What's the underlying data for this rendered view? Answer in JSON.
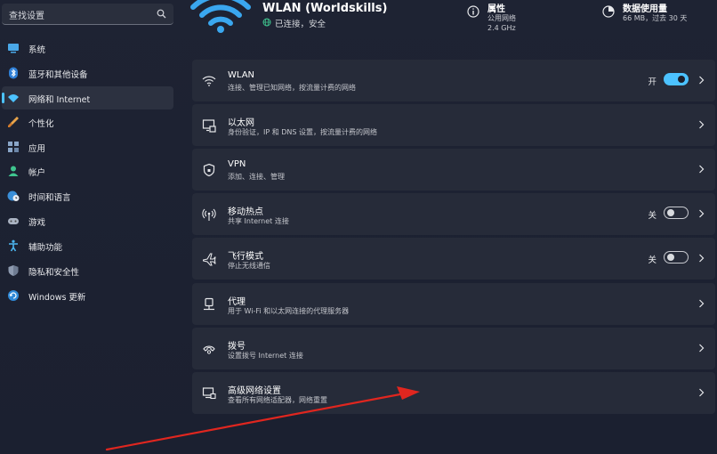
{
  "search": {
    "placeholder": "查找设置"
  },
  "sidebar": {
    "items": [
      {
        "label": "系统",
        "icon": "monitor-icon"
      },
      {
        "label": "蓝牙和其他设备",
        "icon": "bluetooth-icon"
      },
      {
        "label": "网络和 Internet",
        "icon": "wifi-icon",
        "active": true
      },
      {
        "label": "个性化",
        "icon": "brush-icon"
      },
      {
        "label": "应用",
        "icon": "apps-icon"
      },
      {
        "label": "帐户",
        "icon": "account-icon"
      },
      {
        "label": "时间和语言",
        "icon": "globe-clock-icon"
      },
      {
        "label": "游戏",
        "icon": "gamepad-icon"
      },
      {
        "label": "辅助功能",
        "icon": "accessibility-icon"
      },
      {
        "label": "隐私和安全性",
        "icon": "shield-icon"
      },
      {
        "label": "Windows 更新",
        "icon": "update-icon"
      }
    ]
  },
  "header": {
    "network_name": "WLAN (Worldskills)",
    "status": "已连接，安全",
    "properties": {
      "title": "属性",
      "line1": "公用网络",
      "line2": "2.4 GHz"
    },
    "data_usage": {
      "title": "数据使用量",
      "line1": "66 MB，过去 30 天"
    }
  },
  "cards": [
    {
      "title": "WLAN",
      "subtitle": "连接、管理已知网络，按流量计费的网络",
      "icon": "wifi-icon",
      "toggle": {
        "state": "on",
        "label": "开"
      }
    },
    {
      "title": "以太网",
      "subtitle": "身份验证，IP 和 DNS 设置，按流量计费的网络",
      "icon": "ethernet-icon"
    },
    {
      "title": "VPN",
      "subtitle": "添加、连接、管理",
      "icon": "vpn-shield-icon"
    },
    {
      "title": "移动热点",
      "subtitle": "共享 Internet 连接",
      "icon": "hotspot-icon",
      "toggle": {
        "state": "off",
        "label": "关"
      }
    },
    {
      "title": "飞行模式",
      "subtitle": "停止无线通信",
      "icon": "airplane-icon",
      "toggle": {
        "state": "off",
        "label": "关"
      }
    },
    {
      "title": "代理",
      "subtitle": "用于 Wi-Fi 和以太网连接的代理服务器",
      "icon": "proxy-icon"
    },
    {
      "title": "拨号",
      "subtitle": "设置拨号 Internet 连接",
      "icon": "dialup-icon"
    },
    {
      "title": "高级网络设置",
      "subtitle": "查看所有网络适配器，网络重置",
      "icon": "network-adapter-icon"
    }
  ],
  "colors": {
    "accent": "#4cc2ff",
    "annotation_arrow": "#e0261f",
    "card_bg": "#262b39",
    "page_bg": "#1c2130"
  }
}
